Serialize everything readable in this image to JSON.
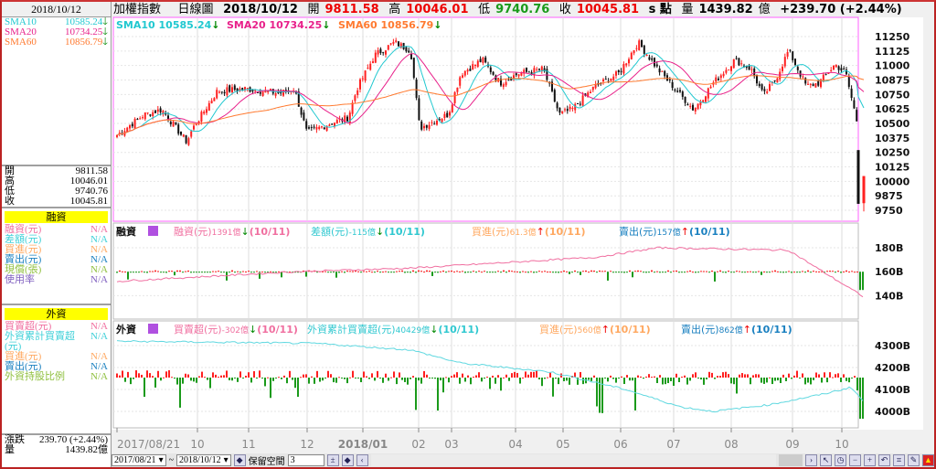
{
  "header": {
    "title": "加權指數",
    "period": "日線圖",
    "date": "2018/10/12",
    "open_label": "開",
    "open": "9811.58",
    "high_label": "高",
    "high": "10046.01",
    "low_label": "低",
    "low": "9740.76",
    "close_label": "收",
    "close": "10045.81",
    "unit": "s 點",
    "vol_label": "量",
    "volume": "1439.82",
    "vol_unit": "億",
    "change": "+239.70 (+2.44%)"
  },
  "colors": {
    "up": "#ff2020",
    "down": "#1a9a1a",
    "sma10": "#20c8d0",
    "sma20": "#e8208a",
    "sma60": "#ff7a30",
    "margin": "#f06fa0",
    "foreign_cum": "#60d8e0",
    "frame": "#b22222"
  },
  "left": {
    "date": "2018/10/12",
    "sma": [
      {
        "label": "SMA10",
        "value": "10585.24"
      },
      {
        "label": "SMA20",
        "value": "10734.25"
      },
      {
        "label": "SMA60",
        "value": "10856.79"
      }
    ],
    "ohlc": [
      {
        "label": "開",
        "value": "9811.58"
      },
      {
        "label": "高",
        "value": "10046.01"
      },
      {
        "label": "低",
        "value": "9740.76"
      },
      {
        "label": "收",
        "value": "10045.81"
      }
    ],
    "margin_title": "融資",
    "margin": [
      {
        "label": "融資(元)",
        "value": "N/A",
        "color": "#f06fa0"
      },
      {
        "label": "差額(元)",
        "value": "N/A",
        "color": "#40d0d8"
      },
      {
        "label": "買進(元)",
        "value": "N/A",
        "color": "#ffa860"
      },
      {
        "label": "賣出(元)",
        "value": "N/A",
        "color": "#1a80c0"
      },
      {
        "label": "現償(張)",
        "value": "N/A",
        "color": "#90c040"
      },
      {
        "label": "使用率",
        "value": "N/A",
        "color": "#8060c0"
      }
    ],
    "foreign_title": "外資",
    "foreign": [
      {
        "label": "買賣超(元)",
        "value": "N/A",
        "color": "#f06fa0"
      },
      {
        "label": "外資累計買賣超(元)",
        "value": "N/A",
        "color": "#40d0d8"
      },
      {
        "label": "買進(元)",
        "value": "N/A",
        "color": "#ffa860"
      },
      {
        "label": "賣出(元)",
        "value": "N/A",
        "color": "#1a80c0"
      },
      {
        "label": "外資持股比例",
        "value": "N/A",
        "color": "#90c040"
      }
    ],
    "change_label": "漲跌",
    "change": "239.70 (+2.44%)",
    "vol_label": "量",
    "volume": "1439.82億"
  },
  "legends": {
    "price": [
      {
        "text": "SMA10 10585.24",
        "arrow": "↓"
      },
      {
        "text": "SMA20 10734.25",
        "arrow": "↓"
      },
      {
        "text": "SMA60 10856.79",
        "arrow": "↓"
      }
    ],
    "margin": {
      "title": "融資",
      "items": [
        {
          "label": "融資(元)",
          "value": "1391億",
          "arrow": "↓",
          "date": "(10/11)"
        },
        {
          "label": "差額(元)",
          "value": "-115億",
          "arrow": "↓",
          "date": "(10/11)"
        },
        {
          "label": "買進(元)",
          "value": "61.3億",
          "arrow": "↑",
          "date": "(10/11)"
        },
        {
          "label": "賣出(元)",
          "value": "157億",
          "arrow": "↑",
          "date": "(10/11)"
        }
      ]
    },
    "foreign": {
      "title": "外資",
      "items": [
        {
          "label": "買賣超(元)",
          "value": "-302億",
          "arrow": "↓",
          "date": "(10/11)"
        },
        {
          "label": "外資累計買賣超(元)",
          "value": "40429億",
          "arrow": "↓",
          "date": "(10/11)"
        },
        {
          "label": "買進(元)",
          "value": "560億",
          "arrow": "↑",
          "date": "(10/11)"
        },
        {
          "label": "賣出(元)",
          "value": "862億",
          "arrow": "↑",
          "date": "(10/11)"
        }
      ]
    }
  },
  "chart_data": [
    {
      "type": "candlestick",
      "title": "加權指數 日線圖",
      "ylim": [
        9700,
        11320
      ],
      "yticks": [
        11250,
        11125,
        11000,
        10875,
        10750,
        10625,
        10500,
        10375,
        10250,
        10125,
        10000,
        9875,
        9750
      ],
      "xticks": [
        "2017/08/21",
        "10",
        "11",
        "12",
        "2018/01",
        "02",
        "03",
        "04",
        "05",
        "06",
        "07",
        "08",
        "09",
        "10"
      ],
      "approx_close": [
        [
          "2017/08/21",
          10400
        ],
        [
          "2017/09/05",
          10575
        ],
        [
          "2017/09/15",
          10620
        ],
        [
          "2017/09/29",
          10340
        ],
        [
          "2017/10/02",
          10450
        ],
        [
          "2017/10/16",
          10780
        ],
        [
          "2017/11/01",
          10800
        ],
        [
          "2017/11/20",
          10760
        ],
        [
          "2017/11/28",
          10800
        ],
        [
          "2017/12/05",
          10420
        ],
        [
          "2017/12/18",
          10500
        ],
        [
          "2017/12/28",
          10550
        ],
        [
          "2018/01/02",
          10800
        ],
        [
          "2018/01/12",
          11090
        ],
        [
          "2018/01/23",
          11200
        ],
        [
          "2018/02/01",
          11130
        ],
        [
          "2018/02/06",
          10460
        ],
        [
          "2018/02/22",
          10580
        ],
        [
          "2018/03/01",
          10930
        ],
        [
          "2018/03/13",
          11050
        ],
        [
          "2018/03/23",
          10850
        ],
        [
          "2018/04/02",
          10930
        ],
        [
          "2018/04/16",
          10970
        ],
        [
          "2018/04/25",
          10580
        ],
        [
          "2018/05/02",
          10620
        ],
        [
          "2018/05/15",
          10820
        ],
        [
          "2018/05/28",
          10930
        ],
        [
          "2018/06/08",
          11200
        ],
        [
          "2018/06/19",
          10970
        ],
        [
          "2018/07/02",
          10740
        ],
        [
          "2018/07/09",
          10620
        ],
        [
          "2018/07/20",
          10850
        ],
        [
          "2018/08/01",
          11050
        ],
        [
          "2018/08/10",
          10970
        ],
        [
          "2018/08/17",
          10740
        ],
        [
          "2018/08/24",
          10890
        ],
        [
          "2018/08/31",
          11130
        ],
        [
          "2018/09/10",
          10820
        ],
        [
          "2018/09/17",
          10850
        ],
        [
          "2018/09/26",
          11010
        ],
        [
          "2018/10/02",
          10930
        ],
        [
          "2018/10/08",
          10530
        ],
        [
          "2018/10/11",
          9806
        ],
        [
          "2018/10/12",
          10045.81
        ]
      ],
      "last": {
        "open": 9811.58,
        "high": 10046.01,
        "low": 9740.76,
        "close": 10045.81
      },
      "series": [
        {
          "name": "SMA10",
          "last": 10585.24
        },
        {
          "name": "SMA20",
          "last": 10734.25
        },
        {
          "name": "SMA60",
          "last": 10856.79
        }
      ]
    },
    {
      "type": "bar+line",
      "title": "融資",
      "yticks": [
        "180B",
        "160B",
        "140B"
      ],
      "ylim": [
        130,
        190
      ],
      "line_approx": [
        [
          "2017/08/21",
          152
        ],
        [
          "2017/11/28",
          160
        ],
        [
          "2018/02/01",
          163
        ],
        [
          "2018/05/15",
          172
        ],
        [
          "2018/06/19",
          180
        ],
        [
          "2018/08/31",
          178
        ],
        [
          "2018/09/17",
          162
        ],
        [
          "2018/10/12",
          139
        ]
      ]
    },
    {
      "type": "bar+line",
      "title": "外資",
      "yticks": [
        "4300B",
        "4200B",
        "4100B",
        "4000B"
      ],
      "ylim": [
        3950,
        4350
      ],
      "line_approx": [
        [
          "2017/08/21",
          4320
        ],
        [
          "2017/12/10",
          4310
        ],
        [
          "2018/02/01",
          4280
        ],
        [
          "2018/03/01",
          4220
        ],
        [
          "2018/04/20",
          4180
        ],
        [
          "2018/06/01",
          4100
        ],
        [
          "2018/07/02",
          4020
        ],
        [
          "2018/07/20",
          4000
        ],
        [
          "2018/08/20",
          4030
        ],
        [
          "2018/09/20",
          4080
        ],
        [
          "2018/10/05",
          4110
        ],
        [
          "2018/10/12",
          4043
        ]
      ]
    }
  ],
  "toolbar": {
    "start_date": "2017/08/21",
    "tilde": "~",
    "end_date": "2018/10/12",
    "reserve_label": "保留空間",
    "reserve_value": "3"
  }
}
